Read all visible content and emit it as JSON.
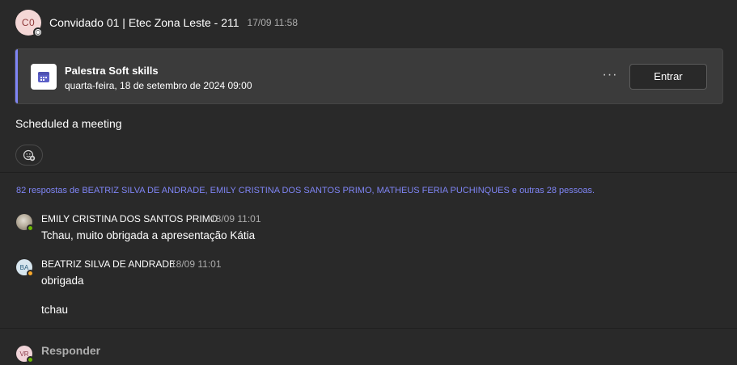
{
  "post": {
    "avatar_initials": "C0",
    "author": "Convidado 01 | Etec Zona Leste - 211",
    "timestamp": "17/09 11:58",
    "meeting_card": {
      "title": "Palestra Soft skills",
      "datetime": "quarta-feira, 18 de setembro de 2024 09:00",
      "more_label": "···",
      "join_label": "Entrar",
      "icon": "calendar-icon"
    },
    "text": "Scheduled a meeting",
    "react_icon": "add-reaction-icon"
  },
  "replies": {
    "summary": "82 respostas de BEATRIZ SILVA DE ANDRADE, EMILY CRISTINA DOS SANTOS PRIMO, MATHEUS FERIA PUCHINQUES e outras 28 pessoas.",
    "items": [
      {
        "author": "EMILY CRISTINA DOS SANTOS PRIMO",
        "time": "18/09 11:01",
        "messages": [
          "Tchau, muito obrigada a apresentação Kátia"
        ],
        "status": "available"
      },
      {
        "author": "BEATRIZ SILVA DE ANDRADE",
        "avatar_initials": "BA",
        "time": "18/09 11:01",
        "messages": [
          "obrigada",
          "tchau"
        ],
        "status": "away"
      }
    ]
  },
  "reply_bar": {
    "avatar_initials": "VR",
    "placeholder": "Responder"
  },
  "colors": {
    "background": "#292929",
    "card": "#3b3b3b",
    "accent": "#7f85f5",
    "available": "#6bb700",
    "away": "#f8a82b"
  }
}
